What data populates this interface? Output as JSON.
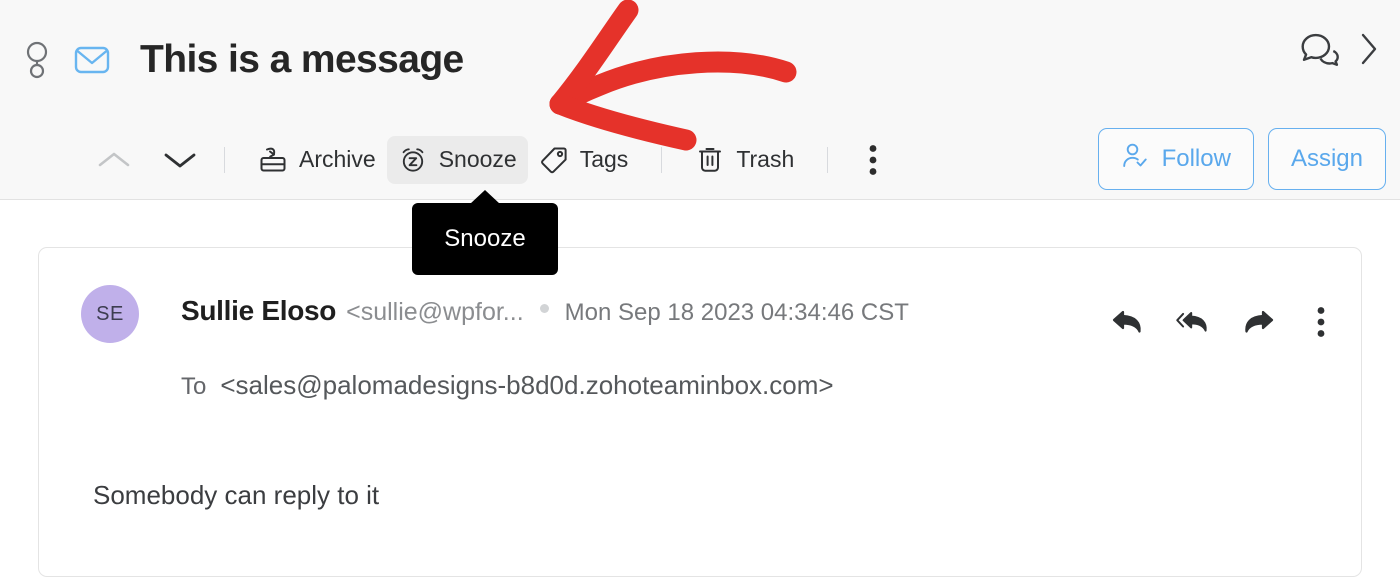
{
  "header": {
    "contact_icon": "contact-person-icon",
    "mail_icon": "envelope-icon",
    "title": "This is a message",
    "comments_icon": "chat-bubbles-icon",
    "expand_icon": "chevron-right-icon"
  },
  "toolbar": {
    "prev_icon": "chevron-up-icon",
    "next_icon": "chevron-down-icon",
    "archive_label": "Archive",
    "archive_icon": "archive-box-icon",
    "snooze_label": "Snooze",
    "snooze_icon": "alarm-clock-z-icon",
    "tags_label": "Tags",
    "tags_icon": "tag-icon",
    "trash_label": "Trash",
    "trash_icon": "trash-bin-icon",
    "more_icon": "more-vertical-icon",
    "follow_label": "Follow",
    "follow_icon": "person-check-icon",
    "assign_label": "Assign"
  },
  "tooltip": {
    "text": "Snooze"
  },
  "message": {
    "avatar_initials": "SE",
    "sender_name": "Sullie Eloso",
    "sender_email": "<sullie@wpfor...",
    "timestamp": "Mon Sep 18 2023 04:34:46 CST",
    "to_label": "To",
    "to_value": "<sales@palomadesigns-b8d0d.zohoteaminbox.com>",
    "body": "Somebody can reply to it",
    "reply_icon": "reply-arrow-icon",
    "reply_all_icon": "reply-all-arrow-icon",
    "forward_icon": "forward-arrow-icon",
    "more_icon": "more-vertical-icon"
  },
  "annotation": {
    "arrow_color": "#e5322a",
    "arrow_icon": "red-curved-arrow-annotation"
  },
  "colors": {
    "accent_blue": "#67b0ef",
    "page_bg": "#f8f8f8",
    "tooltip_bg": "#000000",
    "avatar_bg": "#c0b0ea",
    "annotation_red": "#e5322a"
  }
}
